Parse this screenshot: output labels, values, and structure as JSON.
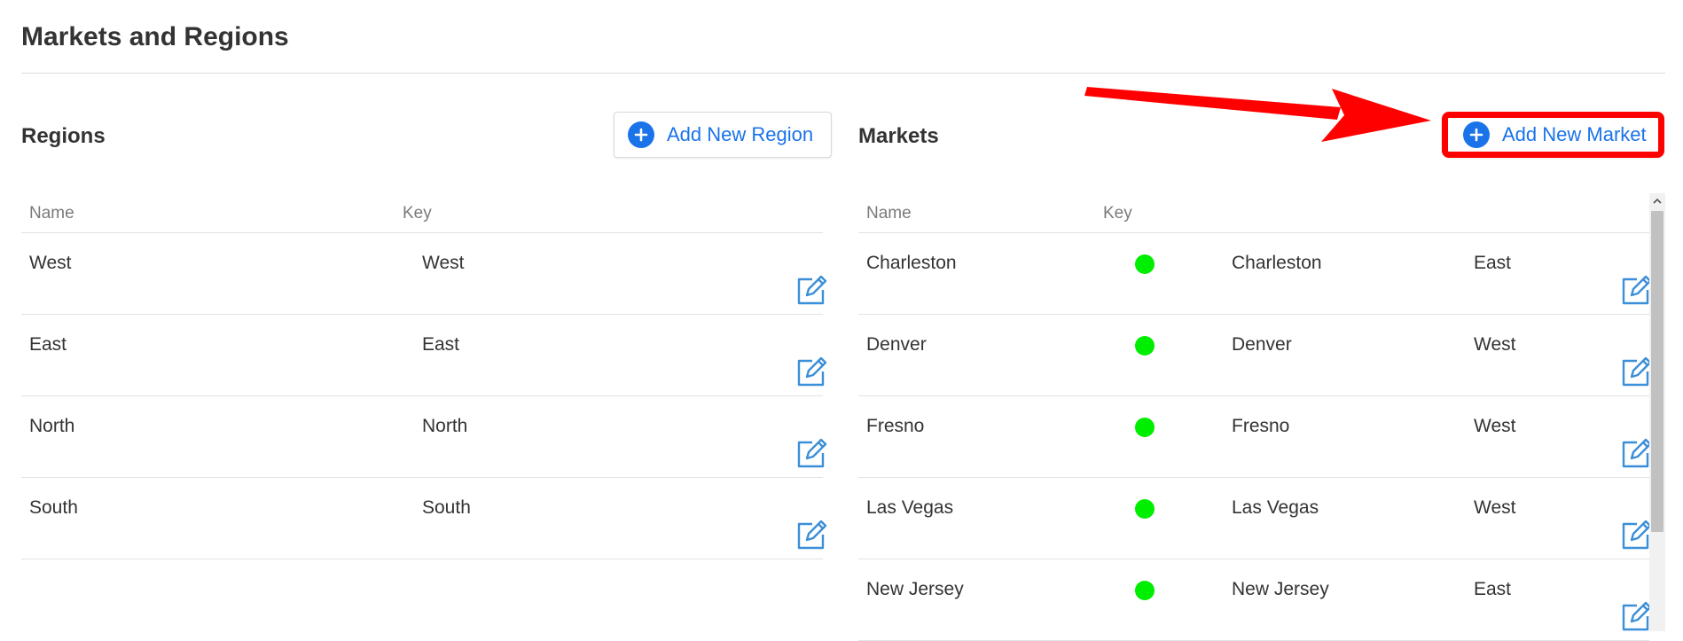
{
  "page": {
    "title": "Markets and Regions"
  },
  "regions": {
    "title": "Regions",
    "add_button_label": "Add New Region",
    "columns": [
      "Name",
      "Key"
    ],
    "rows": [
      {
        "name": "West",
        "key": "West"
      },
      {
        "name": "East",
        "key": "East"
      },
      {
        "name": "North",
        "key": "North"
      },
      {
        "name": "South",
        "key": "South"
      }
    ]
  },
  "markets": {
    "title": "Markets",
    "add_button_label": "Add New Market",
    "columns": [
      "Name",
      "Key"
    ],
    "rows": [
      {
        "name": "Charleston",
        "key": "Charleston",
        "region": "East",
        "status": "active"
      },
      {
        "name": "Denver",
        "key": "Denver",
        "region": "West",
        "status": "active"
      },
      {
        "name": "Fresno",
        "key": "Fresno",
        "region": "West",
        "status": "active"
      },
      {
        "name": "Las Vegas",
        "key": "Las Vegas",
        "region": "West",
        "status": "active"
      },
      {
        "name": "New Jersey",
        "key": "New Jersey",
        "region": "East",
        "status": "active"
      }
    ]
  },
  "colors": {
    "accent": "#1a73e8",
    "status_active": "#00ee00",
    "annotation": "#ff0000",
    "edit_icon": "#3b8fd8"
  },
  "icons": {
    "add": "plus-circle-icon",
    "edit": "edit-icon",
    "status": "status-dot",
    "annotation": "red-arrow"
  }
}
